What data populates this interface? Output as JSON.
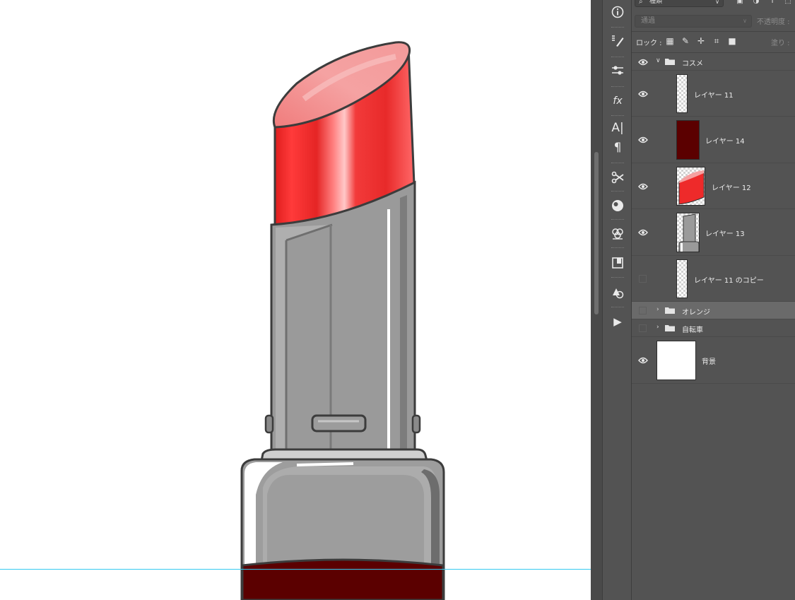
{
  "canvas": {
    "guide_color": "#35c9f0",
    "lipstick_colors": {
      "bullet": "#f03434",
      "tube": "#9a9a9a",
      "base": "#5b0000",
      "outline": "#3c3c3c"
    }
  },
  "toolbar": {
    "tools": [
      {
        "name": "info-icon"
      },
      {
        "name": "brush-settings-icon"
      },
      {
        "name": "adjustments-icon"
      },
      {
        "name": "fx-icon",
        "label": "fx"
      },
      {
        "name": "character-icon",
        "label": "A|"
      },
      {
        "name": "paragraph-icon",
        "label": "¶"
      },
      {
        "name": "tool-presets-icon"
      },
      {
        "name": "color-sphere-icon"
      },
      {
        "name": "swatches-adjust-icon"
      },
      {
        "name": "layer-comps-icon"
      },
      {
        "name": "shapes-icon"
      },
      {
        "name": "play-icon",
        "label": "▶"
      }
    ]
  },
  "layers_panel": {
    "kind_filter": "種類",
    "blend_mode": "通過",
    "opacity_label": "不透明度 :",
    "lock_label": "ロック :",
    "fill_label": "塗り :",
    "layers": [
      {
        "name": "コスメ",
        "type": "group",
        "expanded": true,
        "visible": true
      },
      {
        "name": "レイヤー 11",
        "type": "layer",
        "visible": true,
        "thumb": "checker-sliver"
      },
      {
        "name": "レイヤー 14",
        "type": "layer",
        "visible": true,
        "thumb": "dark-red"
      },
      {
        "name": "レイヤー 12",
        "type": "layer",
        "visible": true,
        "thumb": "red-bullet"
      },
      {
        "name": "レイヤー 13",
        "type": "layer",
        "visible": true,
        "thumb": "grey-tube"
      },
      {
        "name": "レイヤー 11 のコピー",
        "type": "layer",
        "visible": false,
        "thumb": "checker-sliver"
      },
      {
        "name": "オレンジ",
        "type": "group",
        "expanded": false,
        "visible": false,
        "selected": true
      },
      {
        "name": "自転車",
        "type": "group",
        "expanded": false,
        "visible": false
      },
      {
        "name": "背景",
        "type": "background",
        "visible": true,
        "thumb": "white"
      }
    ]
  }
}
